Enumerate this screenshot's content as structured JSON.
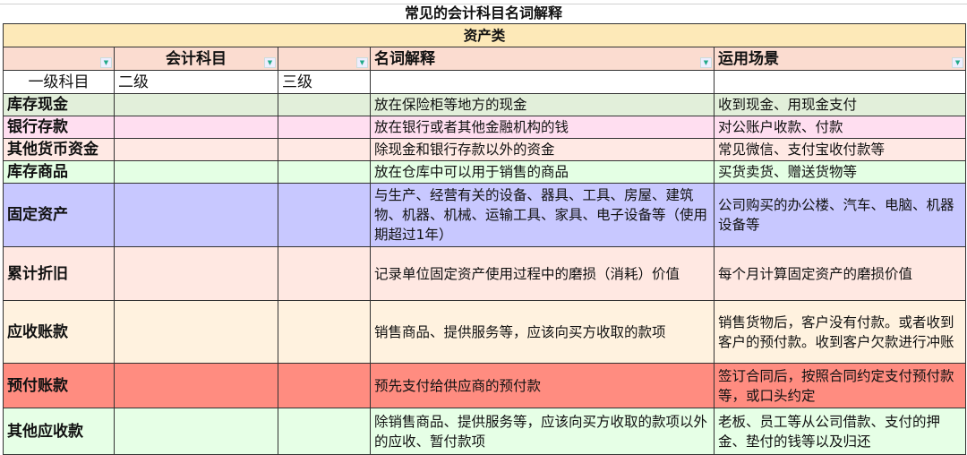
{
  "title": "常见的会计科目名词解释",
  "category": "资产类",
  "headers": {
    "subject": "会计科目",
    "explanation": "名词解释",
    "usage": "运用场景"
  },
  "subheaders": {
    "level1": "一级科目",
    "level2": "二级",
    "level3": "三级"
  },
  "rows": [
    {
      "name": "库存现金",
      "explanation": "放在保险柜等地方的现金",
      "usage": "收到现金、用现金支付",
      "color": "#e2efda"
    },
    {
      "name": "银行存款",
      "explanation": "放在银行或者其他金融机构的钱",
      "usage": "对公账户收款、付款",
      "color": "#ffdef0"
    },
    {
      "name": "其他货币资金",
      "explanation": "除现金和银行存款以外的资金",
      "usage": "常见微信、支付宝收付款等",
      "color": "#ffe9e4"
    },
    {
      "name": "库存商品",
      "explanation": "放在仓库中可以用于销售的商品",
      "usage": "买货卖货、赠送货物等",
      "color": "#e4ffe4"
    },
    {
      "name": "固定资产",
      "explanation": "与生产、经营有关的设备、器具、工具、房屋、建筑物、机器、机械、运输工具、家具、电子设备等（使用期超过1年）",
      "usage": "公司购买的办公楼、汽车、电脑、机器设备等",
      "color": "#c8c8ff"
    },
    {
      "name": "累计折旧",
      "explanation": "记录单位固定资产使用过程中的磨损（消耗）价值",
      "usage": "每个月计算固定资产的磨损价值",
      "color": "#ffe8e2"
    },
    {
      "name": "应收账款",
      "explanation": "销售商品、提供服务等，应该向买方收取的款项",
      "usage": "销售货物后，客户没有付款。或者收到客户的预付款。收到客户欠款进行冲账",
      "color": "#fff2df"
    },
    {
      "name": "预付账款",
      "explanation": "预先支付给供应商的预付款",
      "usage": "签订合同后，按照合同约定支付预付款等，或口头约定",
      "color": "#ff8c80"
    },
    {
      "name": "其他应收款",
      "explanation": "除销售商品、提供服务等，应该向买方收取的款项以外的应收、暂付款项",
      "usage": "老板、员工等从公司借款、支付的押金、垫付的钱等以及归还",
      "color": "#e6ffe6"
    }
  ]
}
